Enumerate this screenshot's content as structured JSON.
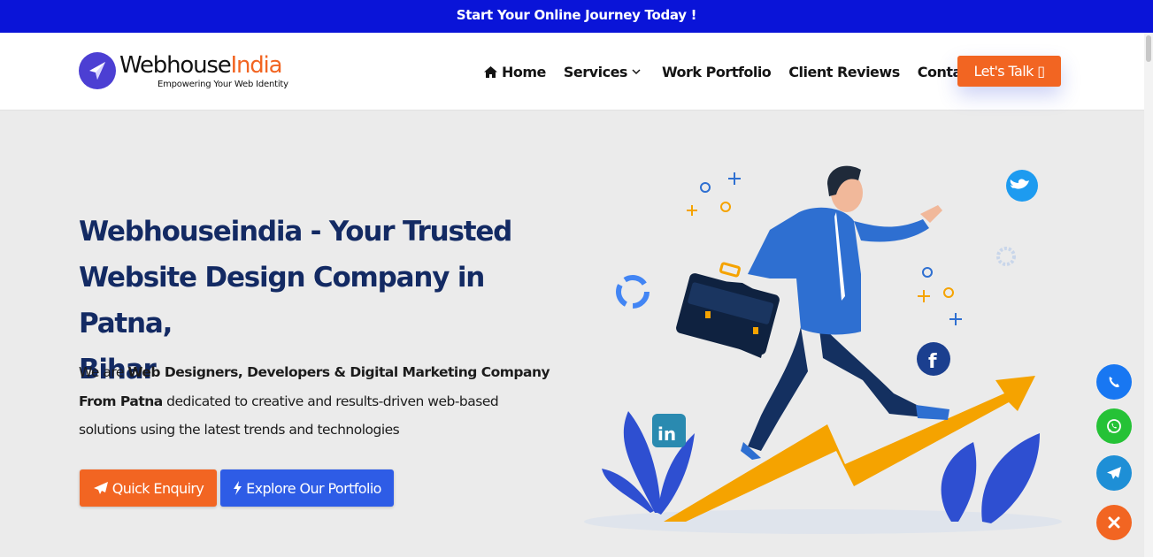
{
  "topbar": {
    "text": "Start Your Online Journey Today !"
  },
  "logo": {
    "name_part1": "Webhouse",
    "name_part2": "India",
    "tagline": "Empowering Your Web Identity"
  },
  "nav": {
    "items": [
      {
        "label": "Home",
        "icon": "home-icon"
      },
      {
        "label": "Services",
        "icon": "chevron-down-icon"
      },
      {
        "label": "Work Portfolio"
      },
      {
        "label": "Client Reviews"
      },
      {
        "label": "Contact us"
      }
    ],
    "cta": "Let's Talk ▯"
  },
  "hero": {
    "title_line1": "Webhouseindia - Your Trusted",
    "title_line2": "Website Design Company in Patna,",
    "title_line3": "Bihar",
    "desc_prefix": "We are ",
    "desc_bold": "Web Designers, Developers & Digital Marketing Company From Patna",
    "desc_suffix": " dedicated to creative and results-driven web-based solutions using the latest trends and technologies",
    "btn_enquiry": "Quick Enquiry",
    "btn_portfolio": "Explore Our Portfolio"
  },
  "floating_buttons": [
    {
      "name": "phone",
      "color": "#1877f2",
      "icon": "phone-icon"
    },
    {
      "name": "whatsapp",
      "color": "#25c236",
      "icon": "whatsapp-icon"
    },
    {
      "name": "telegram",
      "color": "#1e8fd6",
      "icon": "telegram-icon"
    },
    {
      "name": "close",
      "color": "#f26522",
      "icon": "close-icon"
    }
  ],
  "colors": {
    "topbar": "#0a14d8",
    "brand_orange": "#f26522",
    "brand_blue": "#2e5ce6",
    "title_navy": "#132a63"
  }
}
